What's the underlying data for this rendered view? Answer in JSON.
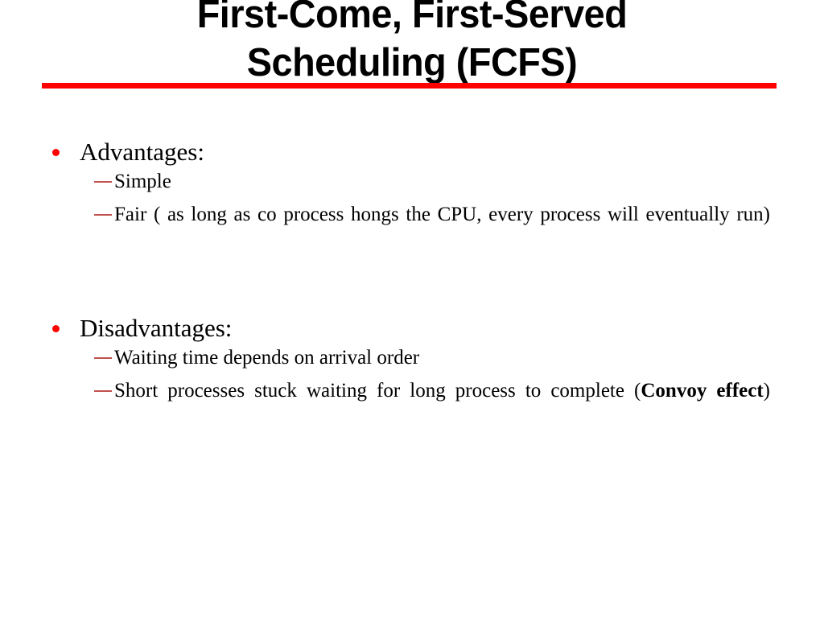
{
  "slide": {
    "title": "First-Come, First-Served\nScheduling (FCFS)",
    "rule_color": "#FF0000",
    "bullet_color": "#FF0000",
    "dash_color": "#C0504D",
    "background_color": "#FFFFFF",
    "text_color": "#000000"
  },
  "content": {
    "groups": [
      {
        "heading": "Advantages:",
        "items": [
          {
            "text": "Simple",
            "bold_text": "",
            "tail_text": ""
          },
          {
            "text": "Fair ( as long as co process hongs the CPU, every process will eventually run)",
            "bold_text": "",
            "tail_text": ""
          }
        ]
      },
      {
        "heading": "Disadvantages:",
        "items": [
          {
            "text": "Waiting time depends on arrival order",
            "bold_text": "",
            "tail_text": ""
          },
          {
            "text": "Short processes stuck waiting for long process to complete (",
            "bold_text": "Convoy effect",
            "tail_text": ")"
          }
        ]
      }
    ]
  }
}
